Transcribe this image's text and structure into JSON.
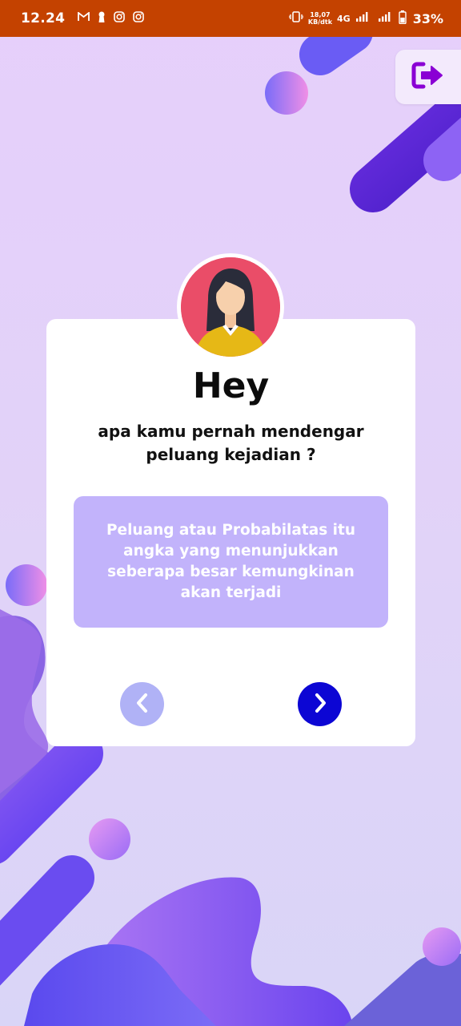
{
  "status_bar": {
    "time": "12.24",
    "network_speed_value": "18,07",
    "network_speed_unit": "KB/dtk",
    "network_type": "4G",
    "battery_percent": "33%"
  },
  "card": {
    "greeting": "Hey",
    "question": "apa kamu pernah mendengar peluang kejadian ?",
    "info": "Peluang atau Probabilatas itu angka yang menunjukkan seberapa besar kemungkinan akan terjadi"
  },
  "colors": {
    "status_bar": "#c44200",
    "info_box": "#c2b3fb",
    "next_button": "#0c06d4",
    "prev_button": "#b0b2f6",
    "logout_icon": "#8a00d4"
  },
  "icons": {
    "logout": "logout-icon",
    "prev": "chevron-left-icon",
    "next": "chevron-right-icon"
  }
}
